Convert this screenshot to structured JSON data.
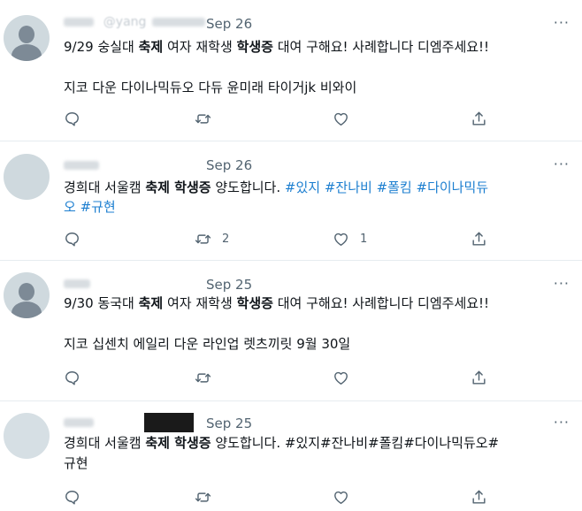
{
  "tweets": [
    {
      "handle": "@yang",
      "date": "Sep 26",
      "more": "···",
      "text1_a": "9/29 숭실대 ",
      "text1_b": "축제",
      "text1_c": " 여자 재학생 ",
      "text1_d": "학생증",
      "text1_e": " 대여 구해요! 사례합니다 디엠주세요!!",
      "text2": "지코 다운 다이나믹듀오 다듀 윤미래 타이거jk 비와이",
      "retweets": "",
      "likes": ""
    },
    {
      "date": "Sep 26",
      "more": "···",
      "text_a": "경희대 서울캠 ",
      "text_b": "축제 학생증",
      "text_c": " 양도합니다. ",
      "tags_line1": "#있지 #잔나비 #폴킴 #다이나믹듀",
      "tags_line2": "오 #규현",
      "retweets": "2",
      "likes": "1"
    },
    {
      "date": "Sep 25",
      "more": "···",
      "text1_a": "9/30 동국대 ",
      "text1_b": "축제",
      "text1_c": " 여자 재학생 ",
      "text1_d": "학생증",
      "text1_e": " 대여 구해요! 사례합니다 디엠주세요!!",
      "text2": "지코 십센치 에일리 다운 라인업 렛츠끼릿 9월 30일",
      "retweets": "",
      "likes": ""
    },
    {
      "date": "Sep 25",
      "more": "···",
      "text_a": "경희대 서울캠 ",
      "text_b": "축제 학생증",
      "text_c": " 양도합니다. #있지#잔나비#폴킴#다이나믹듀오#",
      "text2": "규현",
      "retweets": "",
      "likes": ""
    }
  ],
  "icons": {
    "reply": "reply-icon",
    "retweet": "retweet-icon",
    "like": "heart-icon",
    "share": "share-icon",
    "more": "more-icon"
  },
  "colors": {
    "text": "#0f1419",
    "muted": "#536471",
    "hashtag": "#1d7fd0",
    "divider": "#e6ecf0",
    "avatar_bg": "#cfd9de"
  }
}
